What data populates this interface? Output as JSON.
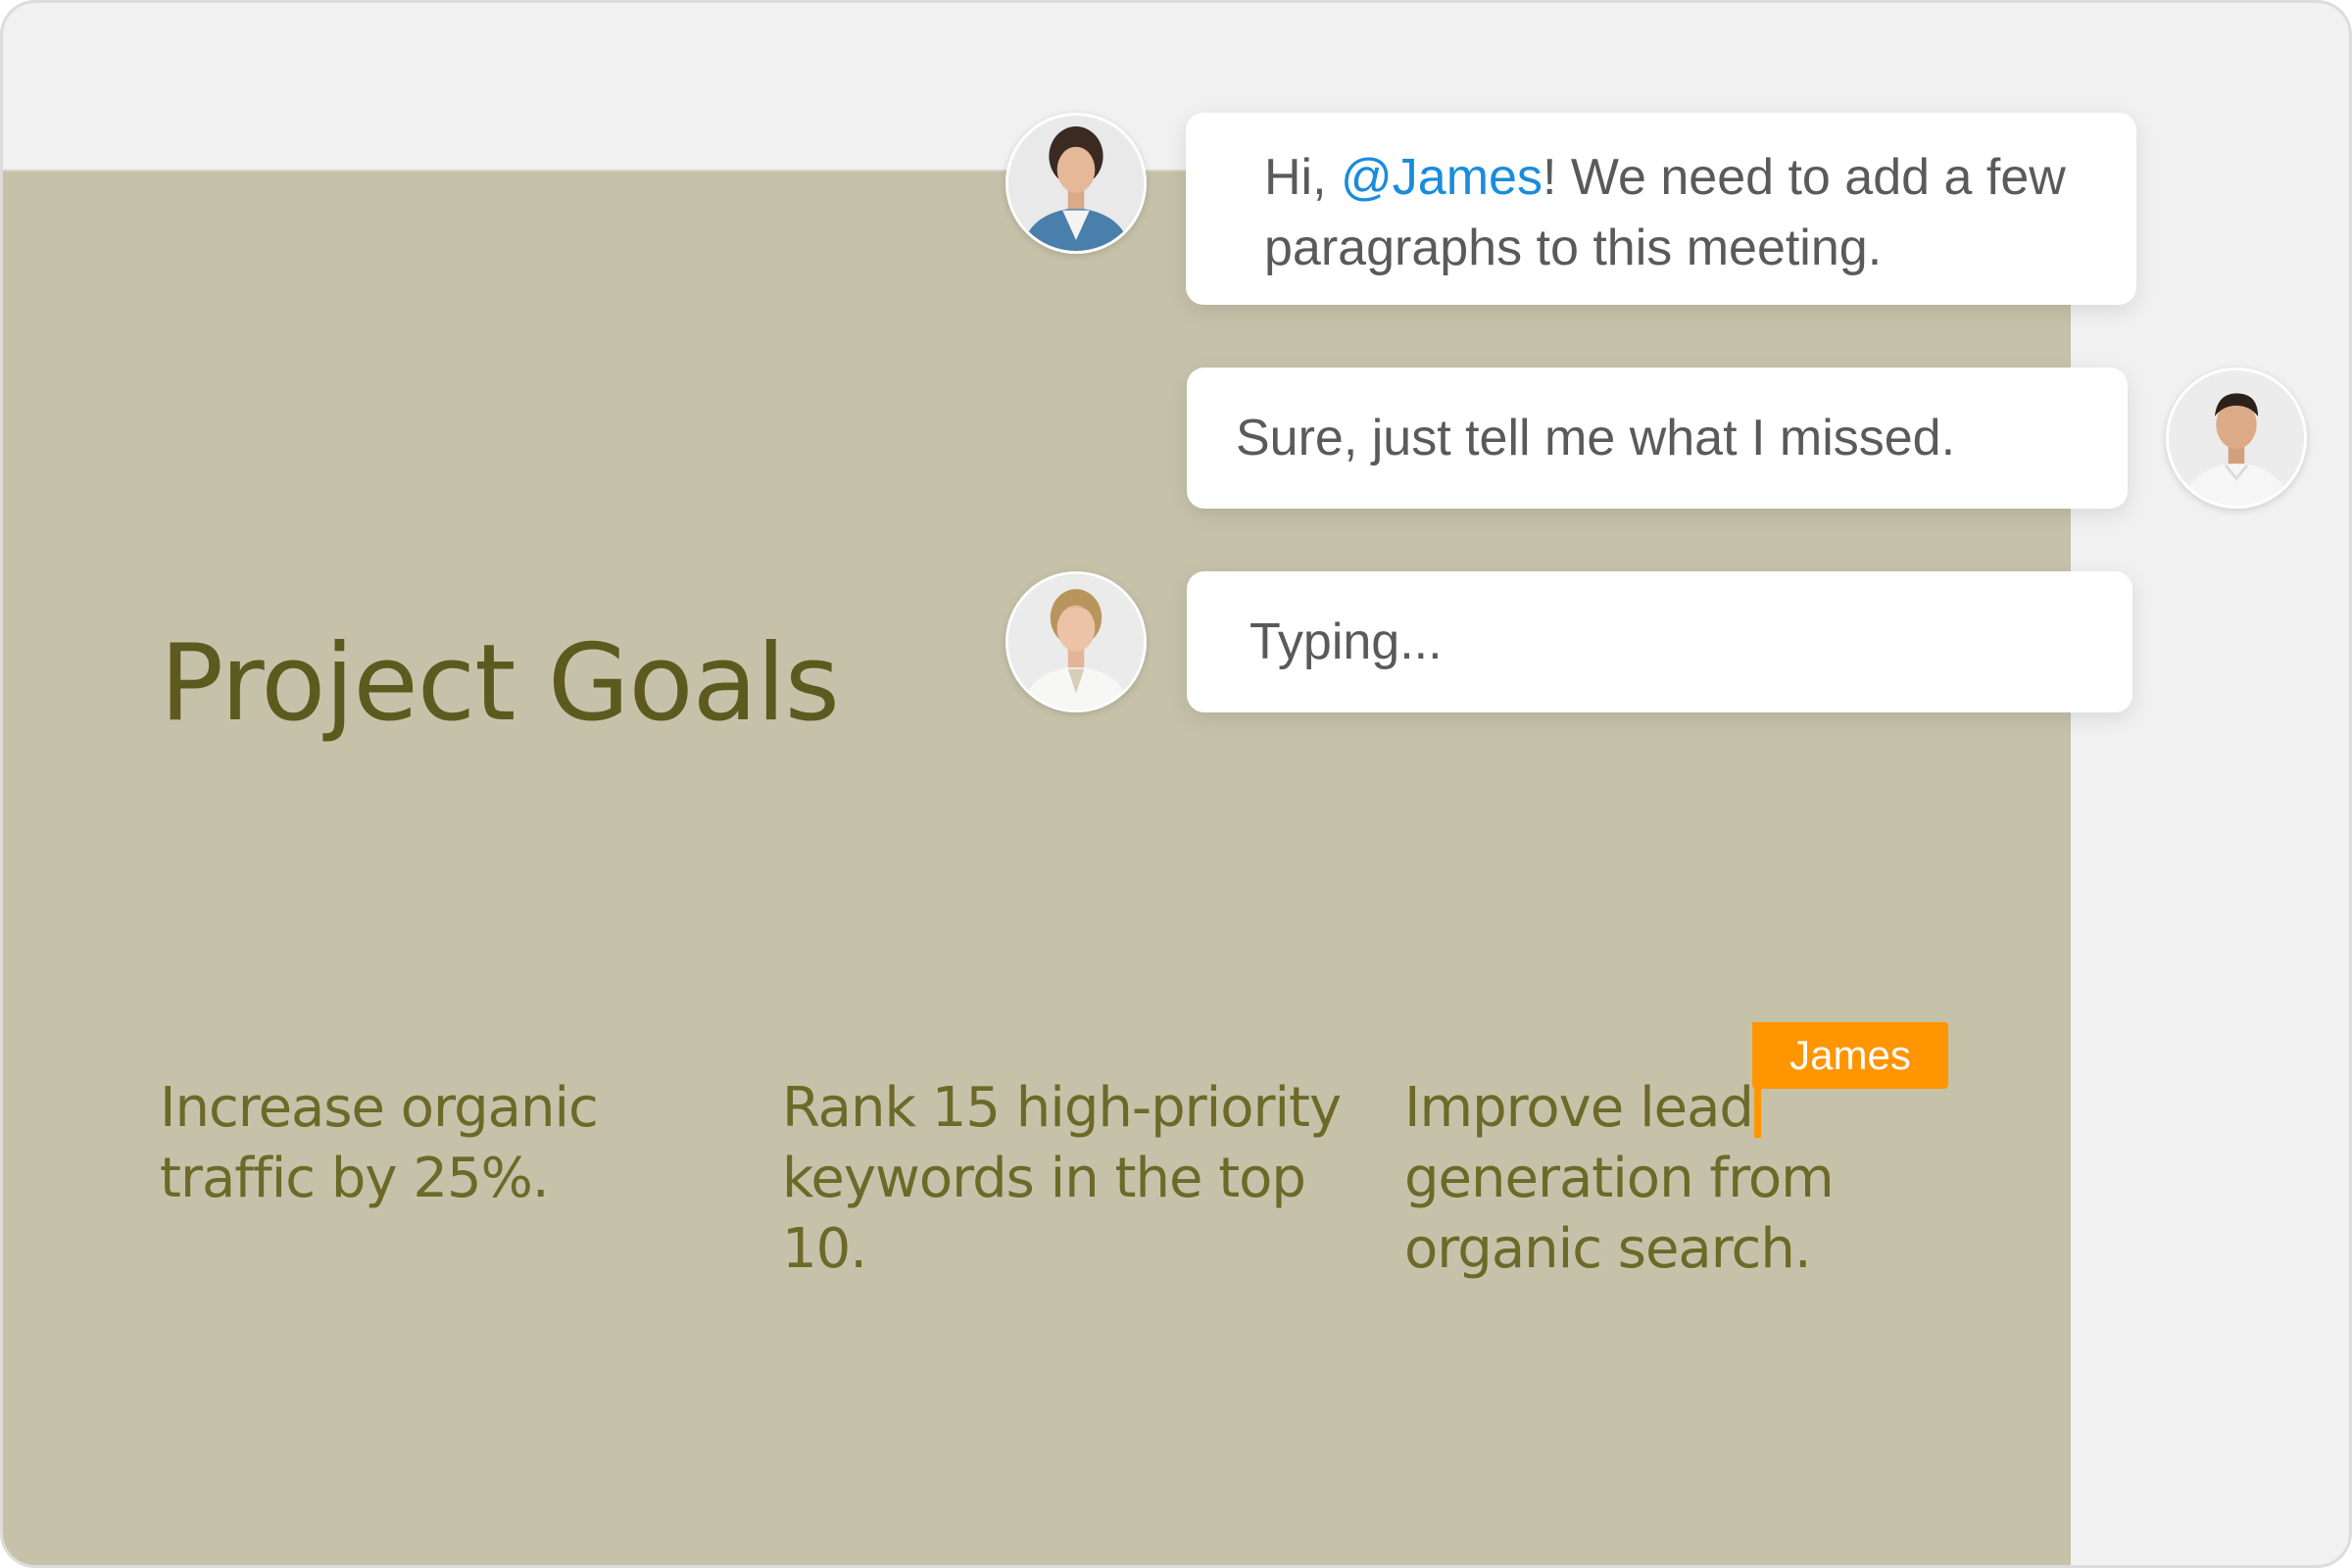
{
  "slide": {
    "title": "Project Goals",
    "goals": [
      "Increase organic traffic by 25%.",
      "Rank 15 high-priority keywords in the top 10.",
      "Improve lead generation from organic search."
    ],
    "cursor_label": "James"
  },
  "chat": {
    "messages": [
      {
        "text_before": "Hi, ",
        "mention": "@James",
        "text_after": "! We need to add a few paragraphs to this meeting."
      },
      {
        "text": "Sure, just tell me what I missed."
      },
      {
        "text": "Typing..."
      }
    ]
  },
  "colors": {
    "slide_background": "#c6c2aa",
    "title_text": "#5d5a1f",
    "goal_text": "#6b6a28",
    "mention": "#1a8cdc",
    "cursor_accent": "#ff9500",
    "window_background": "#f1f1f1"
  }
}
